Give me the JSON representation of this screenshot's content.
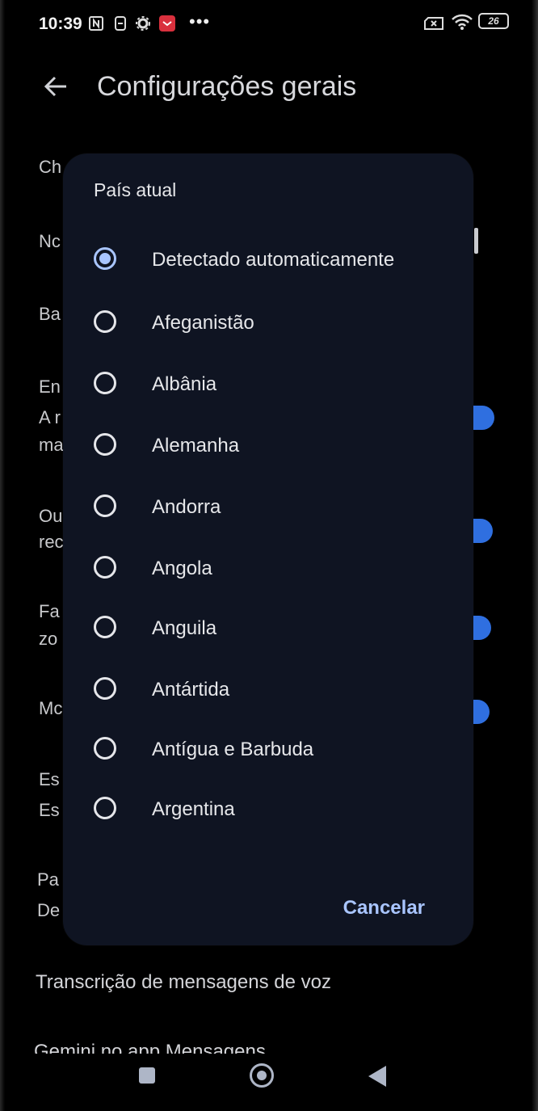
{
  "status_bar": {
    "time": "10:39",
    "battery": "26"
  },
  "header": {
    "title": "Configurações gerais"
  },
  "background_list": [
    "Ch",
    "Nc",
    "Ba",
    "En",
    "A r",
    "ma",
    "Ou",
    "rec",
    "Fa",
    "zo",
    "Mc",
    "Es",
    "Es",
    "Pa",
    "De",
    "Transcrição de mensagens de voz",
    "Gemini no app Mensagens"
  ],
  "dialog": {
    "title": "País atual",
    "options": [
      {
        "label": "Detectado automaticamente",
        "selected": true
      },
      {
        "label": "Afeganistão",
        "selected": false
      },
      {
        "label": "Albânia",
        "selected": false
      },
      {
        "label": "Alemanha",
        "selected": false
      },
      {
        "label": "Andorra",
        "selected": false
      },
      {
        "label": "Angola",
        "selected": false
      },
      {
        "label": "Anguila",
        "selected": false
      },
      {
        "label": "Antártida",
        "selected": false
      },
      {
        "label": "Antígua e Barbuda",
        "selected": false
      },
      {
        "label": "Argentina",
        "selected": false
      }
    ],
    "cancel_label": "Cancelar"
  },
  "colors": {
    "accent": "#a9c5ff",
    "toggle": "#2f6fe0",
    "dialog_bg": "#0f1422"
  }
}
